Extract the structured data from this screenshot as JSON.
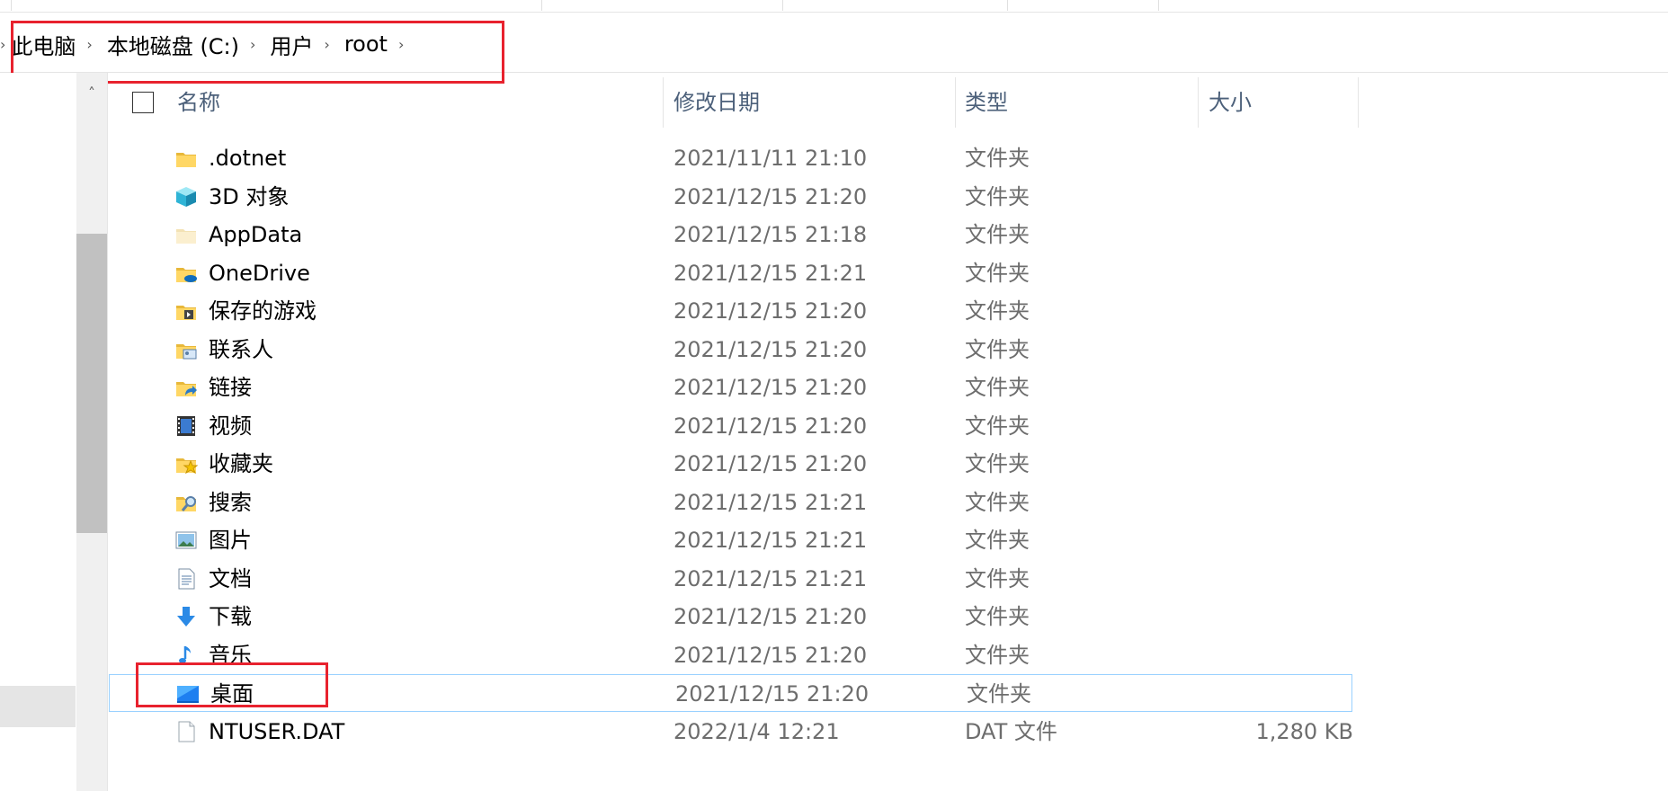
{
  "breadcrumb": {
    "items": [
      "此电脑",
      "本地磁盘 (C:)",
      "用户",
      "root"
    ],
    "separator": "›"
  },
  "columns": {
    "name": "名称",
    "modified": "修改日期",
    "type": "类型",
    "size": "大小"
  },
  "files": [
    {
      "name": ".dotnet",
      "date": "2021/11/11 21:10",
      "type": "文件夹",
      "size": "",
      "icon": "folder-icon"
    },
    {
      "name": "3D 对象",
      "date": "2021/12/15 21:20",
      "type": "文件夹",
      "size": "",
      "icon": "3d-objects-icon"
    },
    {
      "name": "AppData",
      "date": "2021/12/15 21:18",
      "type": "文件夹",
      "size": "",
      "icon": "hidden-folder-icon"
    },
    {
      "name": "OneDrive",
      "date": "2021/12/15 21:21",
      "type": "文件夹",
      "size": "",
      "icon": "onedrive-folder-icon"
    },
    {
      "name": "保存的游戏",
      "date": "2021/12/15 21:20",
      "type": "文件夹",
      "size": "",
      "icon": "saved-games-icon"
    },
    {
      "name": "联系人",
      "date": "2021/12/15 21:20",
      "type": "文件夹",
      "size": "",
      "icon": "contacts-icon"
    },
    {
      "name": "链接",
      "date": "2021/12/15 21:20",
      "type": "文件夹",
      "size": "",
      "icon": "links-icon"
    },
    {
      "name": "视频",
      "date": "2021/12/15 21:20",
      "type": "文件夹",
      "size": "",
      "icon": "videos-icon"
    },
    {
      "name": "收藏夹",
      "date": "2021/12/15 21:20",
      "type": "文件夹",
      "size": "",
      "icon": "favorites-icon"
    },
    {
      "name": "搜索",
      "date": "2021/12/15 21:21",
      "type": "文件夹",
      "size": "",
      "icon": "searches-icon"
    },
    {
      "name": "图片",
      "date": "2021/12/15 21:21",
      "type": "文件夹",
      "size": "",
      "icon": "pictures-icon"
    },
    {
      "name": "文档",
      "date": "2021/12/15 21:21",
      "type": "文件夹",
      "size": "",
      "icon": "documents-icon"
    },
    {
      "name": "下载",
      "date": "2021/12/15 21:20",
      "type": "文件夹",
      "size": "",
      "icon": "downloads-icon"
    },
    {
      "name": "音乐",
      "date": "2021/12/15 21:20",
      "type": "文件夹",
      "size": "",
      "icon": "music-icon"
    },
    {
      "name": "桌面",
      "date": "2021/12/15 21:20",
      "type": "文件夹",
      "size": "",
      "icon": "desktop-icon"
    },
    {
      "name": "NTUSER.DAT",
      "date": "2022/1/4 12:21",
      "type": "DAT 文件",
      "size": "1,280 KB",
      "icon": "file-icon"
    }
  ],
  "selected_row": 14,
  "colors": {
    "highlight_box": "#e8222e",
    "folder": "#ffd765",
    "selection_border": "#99d1ff",
    "header_text": "#4c607a"
  }
}
